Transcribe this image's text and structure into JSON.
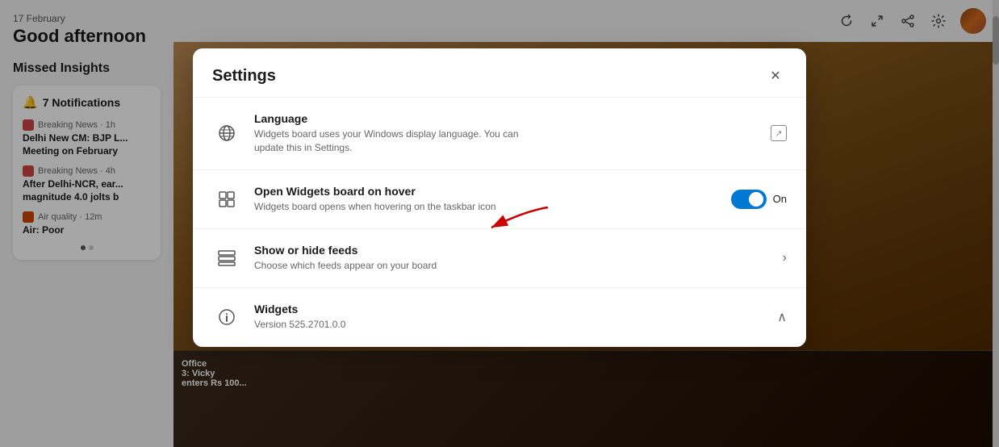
{
  "header": {
    "date": "17 February",
    "greeting": "Good afternoon"
  },
  "sidebar": {
    "missed_insights_label": "Missed Insights",
    "notifications_count": "7 Notifications",
    "news_items": [
      {
        "source": "Breaking News",
        "time": "1h",
        "title": "Delhi New CM: BJP L... Meeting on February"
      },
      {
        "source": "Breaking News",
        "time": "4h",
        "title": "After Delhi-NCR, ear... magnitude 4.0 jolts b"
      },
      {
        "source": "Air quality",
        "time": "12m",
        "title": "Air: Poor"
      }
    ]
  },
  "modal": {
    "title": "Settings",
    "close_label": "✕",
    "items": [
      {
        "icon": "language-icon",
        "title": "Language",
        "description": "Widgets board uses your Windows display language. You can update this in Settings.",
        "action_type": "external-link"
      },
      {
        "icon": "widgets-hover-icon",
        "title": "Open Widgets board on hover",
        "description": "Widgets board opens when hovering on the taskbar icon",
        "action_type": "toggle",
        "toggle_state": true,
        "toggle_label": "On"
      },
      {
        "icon": "feeds-icon",
        "title": "Show or hide feeds",
        "description": "Choose which feeds appear on your board",
        "action_type": "chevron-right"
      },
      {
        "icon": "widgets-version-icon",
        "title": "Widgets",
        "description": "Version 525.2701.0.0",
        "action_type": "chevron-up"
      }
    ]
  },
  "topbar_icons": [
    "refresh-icon",
    "expand-icon",
    "share-icon",
    "settings-icon"
  ]
}
